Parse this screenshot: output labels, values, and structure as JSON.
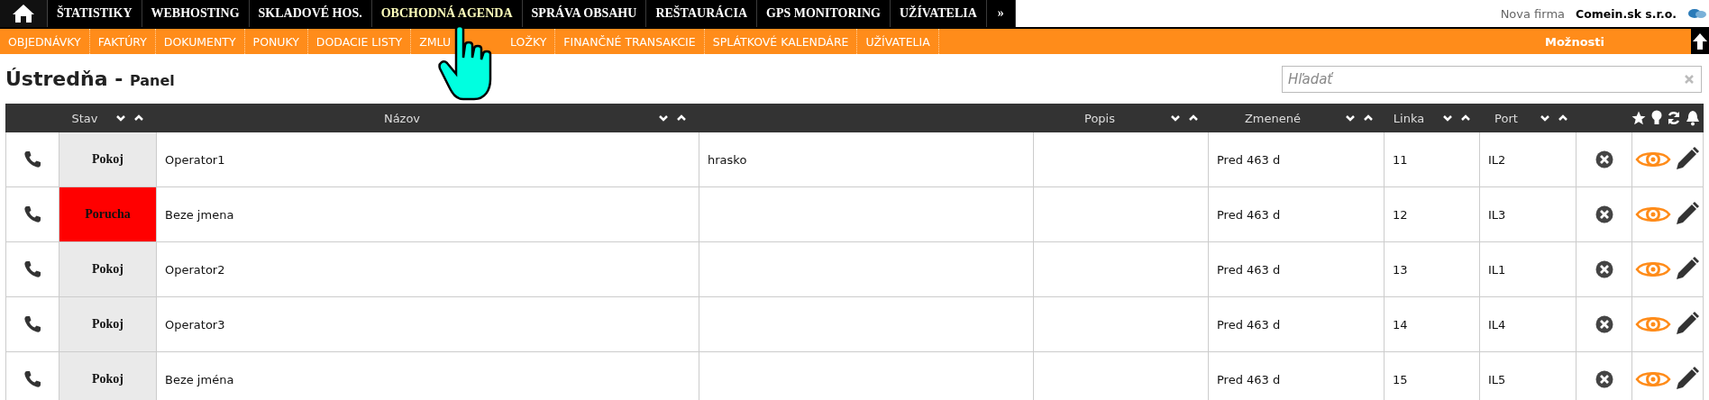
{
  "top_nav": {
    "items": [
      {
        "label": "ŠTATISTIKY",
        "selected": false
      },
      {
        "label": "WEBHOSTING",
        "selected": false
      },
      {
        "label": "SKLADOVÉ HOS.",
        "selected": false
      },
      {
        "label": "OBCHODNÁ AGENDA",
        "selected": true
      },
      {
        "label": "SPRÁVA OBSAHU",
        "selected": false
      },
      {
        "label": "REŠTAURÁCIA",
        "selected": false
      },
      {
        "label": "GPS MONITORING",
        "selected": false
      },
      {
        "label": "UŽÍVATELIA",
        "selected": false
      }
    ],
    "more": "»",
    "company_hint": "Nova firma",
    "company": "Comein.sk s.r.o."
  },
  "sub_nav": {
    "items": [
      {
        "label": "OBJEDNÁVKY"
      },
      {
        "label": "FAKTÚRY"
      },
      {
        "label": "DOKUMENTY"
      },
      {
        "label": "PONUKY"
      },
      {
        "label": "DODACIE LISTY"
      },
      {
        "label": "ZMLU",
        "covered_rest": "LOŽKY"
      },
      {
        "label": "FINANČNÉ TRANSAKCIE"
      },
      {
        "label": "SPLÁTKOVÉ KALENDÁRE"
      },
      {
        "label": "UŽÍVATELIA"
      }
    ],
    "options": "Možnosti"
  },
  "page": {
    "title": "Ústredňa -",
    "subtitle": "Panel",
    "search": {
      "placeholder": "Hľadať"
    }
  },
  "table": {
    "columns": [
      "Stav",
      "Názov",
      "Popis",
      "Zmenené",
      "Linka",
      "Port"
    ],
    "rows": [
      {
        "state": "Pokoj",
        "alarm": false,
        "name": "Operator1",
        "column_4": "hrasko",
        "changed": "Pred 463 d",
        "line": "11",
        "port": "IL2"
      },
      {
        "state": "Porucha",
        "alarm": true,
        "name": "Beze jmena",
        "changed": "Pred 463 d",
        "line": "12",
        "port": "IL3"
      },
      {
        "state": "Pokoj",
        "alarm": false,
        "name": "Operator2",
        "changed": "Pred 463 d",
        "line": "13",
        "port": "IL1"
      },
      {
        "state": "Pokoj",
        "alarm": false,
        "name": "Operator3",
        "changed": "Pred 463 d",
        "line": "14",
        "port": "IL4"
      },
      {
        "state": "Pokoj",
        "alarm": false,
        "name": "Beze jména",
        "changed": "Pred 463 d",
        "line": "15",
        "port": "IL5"
      }
    ]
  }
}
